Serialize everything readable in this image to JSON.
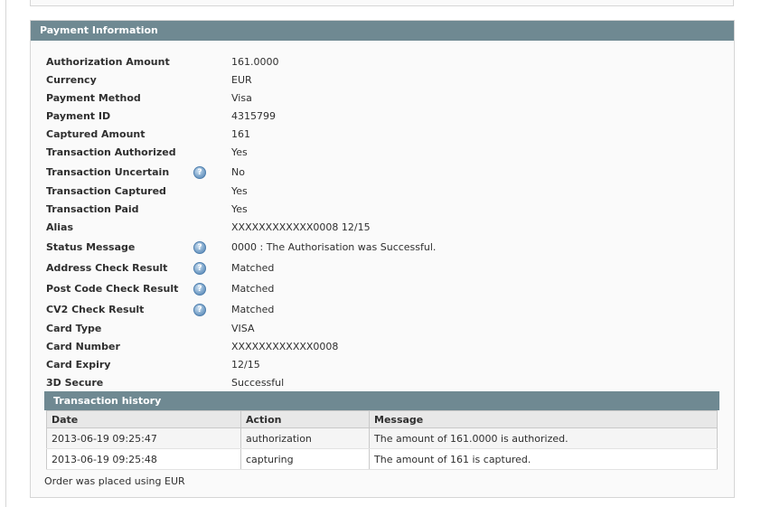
{
  "section": {
    "title": "Payment Information"
  },
  "fields": [
    {
      "label": "Authorization Amount",
      "value": "161.0000",
      "help": false
    },
    {
      "label": "Currency",
      "value": "EUR",
      "help": false
    },
    {
      "label": "Payment Method",
      "value": "Visa",
      "help": false
    },
    {
      "label": "Payment ID",
      "value": "4315799",
      "help": false
    },
    {
      "label": "Captured Amount",
      "value": "161",
      "help": false
    },
    {
      "label": "Transaction Authorized",
      "value": "Yes",
      "help": false
    },
    {
      "label": "Transaction Uncertain",
      "value": "No",
      "help": true
    },
    {
      "label": "Transaction Captured",
      "value": "Yes",
      "help": false
    },
    {
      "label": "Transaction Paid",
      "value": "Yes",
      "help": false
    },
    {
      "label": "Alias",
      "value": "XXXXXXXXXXXX0008 12/15",
      "help": false
    },
    {
      "label": "Status Message",
      "value": "0000 : The Authorisation was Successful.",
      "help": true
    },
    {
      "label": "Address Check Result",
      "value": "Matched",
      "help": true
    },
    {
      "label": "Post Code Check Result",
      "value": "Matched",
      "help": true
    },
    {
      "label": "CV2 Check Result",
      "value": "Matched",
      "help": true
    },
    {
      "label": "Card Type",
      "value": "VISA",
      "help": false
    },
    {
      "label": "Card Number",
      "value": "XXXXXXXXXXXX0008",
      "help": false
    },
    {
      "label": "Card Expiry",
      "value": "12/15",
      "help": false
    },
    {
      "label": "3D Secure",
      "value": "Successful",
      "help": false
    }
  ],
  "help_icon": {
    "name": "help-icon",
    "glyph": "?"
  },
  "history": {
    "title": "Transaction history",
    "columns": [
      "Date",
      "Action",
      "Message"
    ],
    "rows": [
      [
        "2013-06-19 09:25:47",
        "authorization",
        "The amount of 161.0000 is authorized."
      ],
      [
        "2013-06-19 09:25:48",
        "capturing",
        "The amount of 161 is captured."
      ]
    ]
  },
  "footnote": "Order was placed using EUR",
  "colors": {
    "header_bg": "#6f8992",
    "panel_bg": "#fafafa",
    "border": "#d6d6d6"
  }
}
